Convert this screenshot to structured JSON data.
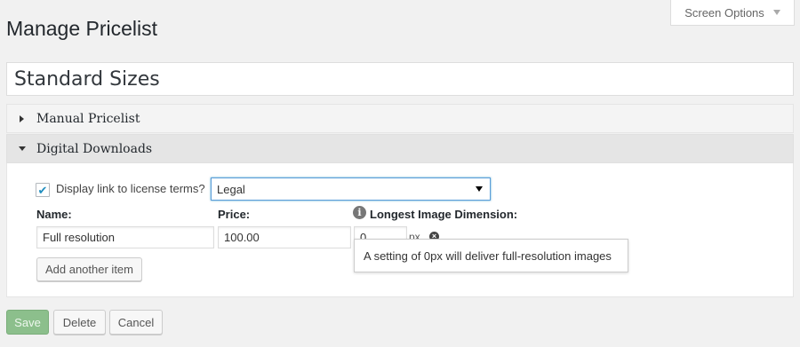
{
  "header": {
    "screen_options_label": "Screen Options",
    "page_title": "Manage Pricelist"
  },
  "pricelist": {
    "title_value": "Standard Sizes"
  },
  "sections": {
    "manual": {
      "label": "Manual Pricelist",
      "expanded": false
    },
    "digital": {
      "label": "Digital Downloads",
      "expanded": true
    }
  },
  "digital": {
    "license_checkbox_label": "Display link to license terms?",
    "license_checked": true,
    "license_select_value": "Legal",
    "columns": {
      "name": "Name:",
      "price": "Price:",
      "dimension": "Longest Image Dimension:"
    },
    "item": {
      "name": "Full resolution",
      "price": "100.00",
      "dimension": "0",
      "unit": "px"
    },
    "tooltip": "A setting of 0px will deliver full-resolution images",
    "add_button": "Add another item"
  },
  "footer": {
    "save": "Save",
    "delete": "Delete",
    "cancel": "Cancel"
  },
  "icons": {
    "checkbox_check": "✔",
    "info": "i",
    "remove": "×"
  },
  "colors": {
    "save_button": "#8cbf8c",
    "select_focus": "#5b9dd9",
    "check": "#1e8cbe"
  }
}
